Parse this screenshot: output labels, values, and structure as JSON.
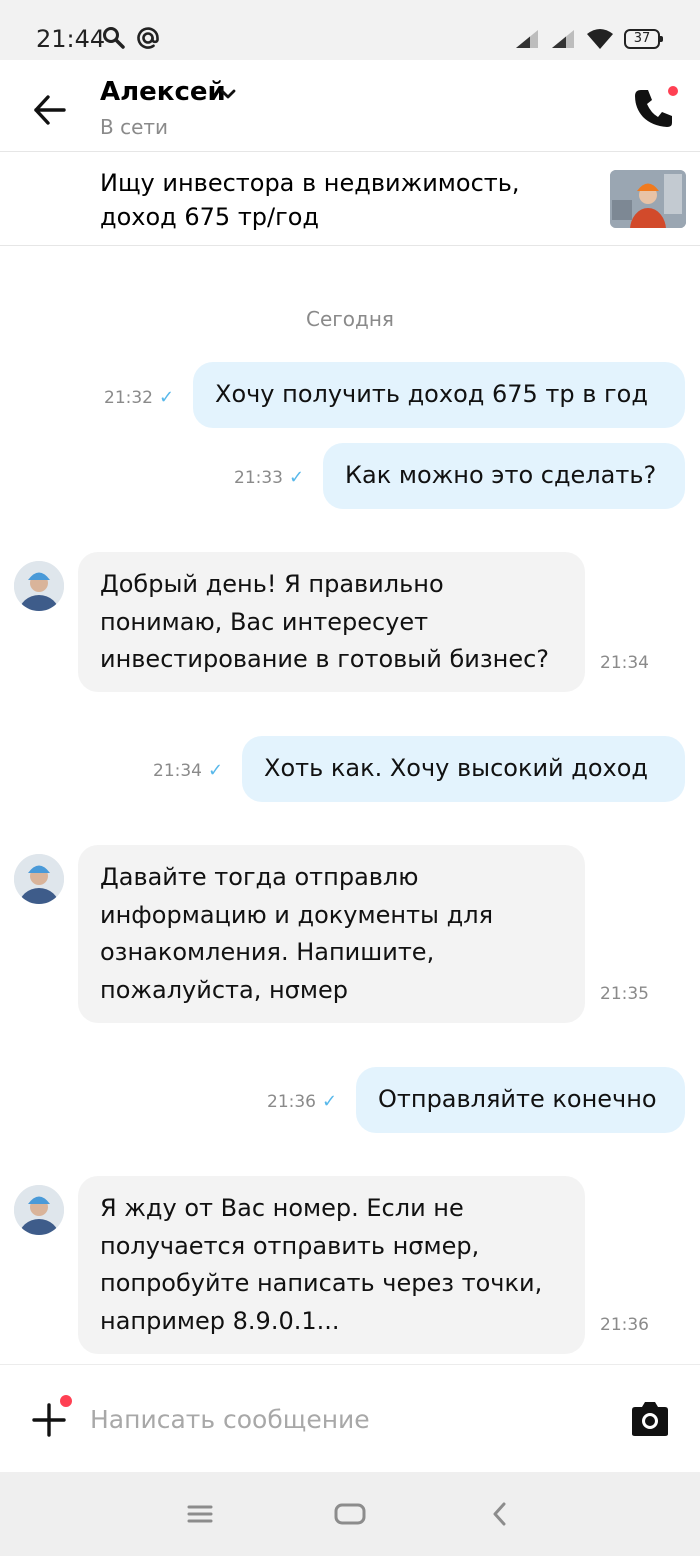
{
  "status_bar": {
    "time": "21:44",
    "battery": "37",
    "icons": [
      "search-icon",
      "at-icon",
      "signal-icon",
      "signal-icon",
      "wifi-icon",
      "battery-icon"
    ]
  },
  "header": {
    "name": "Алексей",
    "status": "В сети",
    "icons": [
      "back-arrow-icon",
      "chevron-down-icon",
      "phone-icon"
    ],
    "notification_color": "#ff4053"
  },
  "ad": {
    "title": "Ищу инвестора в недвижимость, доход 675 тр/год"
  },
  "chat": {
    "date_separator": "Сегодня",
    "messages": [
      {
        "dir": "out",
        "text": "Хочу получить доход 675 тр в год",
        "time": "21:32"
      },
      {
        "dir": "out",
        "text": "Как можно это сделать?",
        "time": "21:33"
      },
      {
        "dir": "in",
        "lines": [
          "Добрый день! Я правильно",
          "понимаю, Вас интересует",
          "инвестирование в готовый бизнес?"
        ],
        "time": "21:34"
      },
      {
        "dir": "out",
        "text": "Хоть как. Хочу высокий доход",
        "time": "21:34"
      },
      {
        "dir": "in",
        "lines": [
          "Давайте тогда отправлю",
          "информацию и документы для",
          "ознакомления. Напишите,",
          "пожалуйста, нσмер"
        ],
        "time": "21:35"
      },
      {
        "dir": "out",
        "text": "Отправляйте конечно",
        "time": "21:36"
      },
      {
        "dir": "in",
        "lines": [
          "Я жду от Вас номер. Если не",
          "получается отпρавить нσмер,",
          "попробуйте написать через точки,",
          "например 8.9.0.1..."
        ],
        "time": "21:36"
      }
    ],
    "read_check": "✓",
    "colors": {
      "outgoing_bubble": "#e3f3fd",
      "incoming_bubble": "#f3f3f3",
      "check": "#58b8ea"
    }
  },
  "composer": {
    "placeholder": "Написать сообщение",
    "icons": [
      "plus-icon",
      "camera-icon"
    ]
  },
  "nav_bar": {
    "icons": [
      "menu-icon",
      "home-icon",
      "back-icon"
    ]
  }
}
